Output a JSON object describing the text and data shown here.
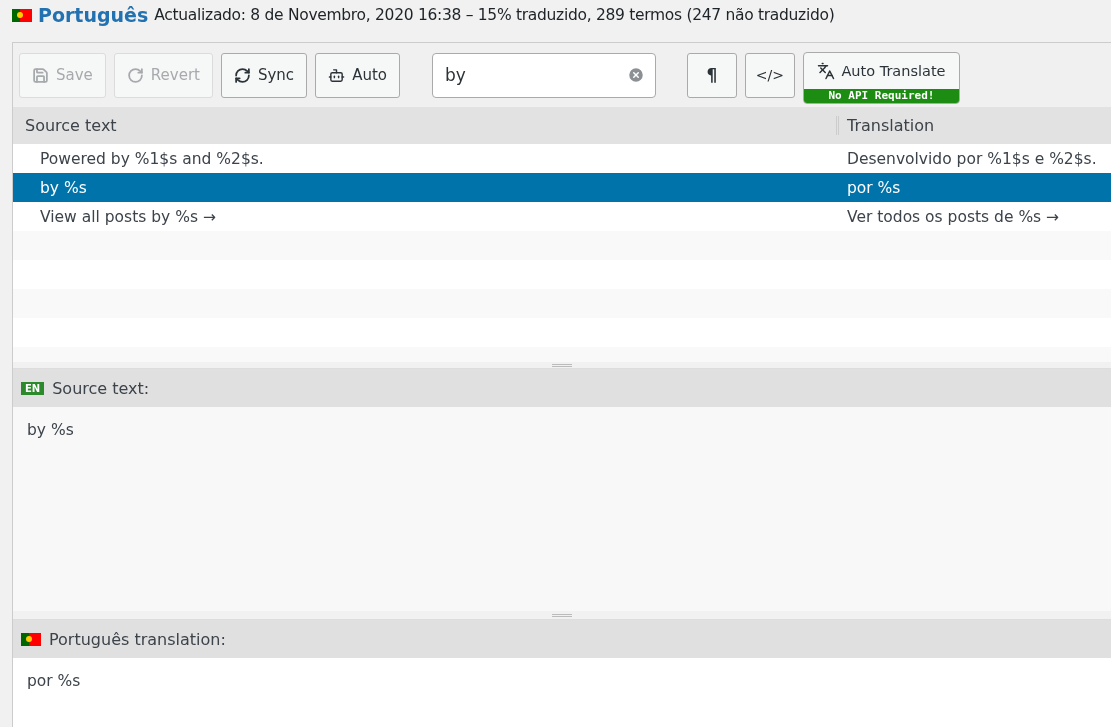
{
  "header": {
    "language": "Português",
    "meta": "Actualizado: 8 de Novembro, 2020 16:38 – 15% traduzido, 289 termos (247 não traduzido)"
  },
  "toolbar": {
    "buttons": [
      {
        "kind": "save",
        "label": "Save",
        "disabled": true
      },
      {
        "kind": "revert",
        "label": "Revert",
        "disabled": true
      },
      {
        "kind": "sync",
        "label": "Sync",
        "disabled": false
      },
      {
        "kind": "auto",
        "label": "Auto",
        "disabled": false
      }
    ],
    "search": {
      "value": "by"
    },
    "toggles": [
      {
        "kind": "pilcrow",
        "label": "¶"
      },
      {
        "kind": "code",
        "label": "</>"
      }
    ],
    "auto_translate": {
      "label": "Auto Translate",
      "badge": "No API Required!"
    }
  },
  "table": {
    "columns": [
      "Source text",
      "Translation"
    ],
    "rows": [
      {
        "source": "Powered by %1$s and %2$s.",
        "translation": "Desenvolvido por %1$s e %2$s.",
        "selected": false
      },
      {
        "source": "by %s",
        "translation": "por %s",
        "selected": true
      },
      {
        "source": "View all posts by %s →",
        "translation": "Ver todos os posts de %s →",
        "selected": false
      }
    ]
  },
  "source_panel": {
    "lang_badge": "EN",
    "title": "Source text:",
    "text": "by %s"
  },
  "translation_panel": {
    "title": "Português translation:",
    "text": "por %s"
  }
}
